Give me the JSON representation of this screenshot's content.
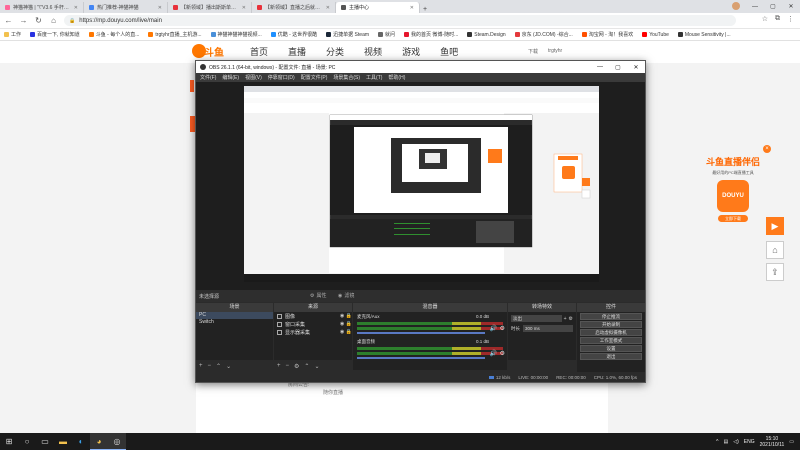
{
  "browser": {
    "tabs": [
      {
        "label": "神猫神猫 | ''\\\"V3.6 手杆→bilib",
        "color": "#ff6699",
        "active": false
      },
      {
        "label": "热门推荐-神猫神猫",
        "color": "#4285f4",
        "active": false
      },
      {
        "label": "【新领域】播出斯斯单中国-Gro",
        "color": "#e8313b",
        "active": false
      },
      {
        "label": "【新领域】直播之后就有分播出",
        "color": "#e8313b",
        "active": false
      },
      {
        "label": "主播中心",
        "color": "#555555",
        "active": true
      }
    ],
    "url": "https://mp.douyu.com/live/main",
    "bookmarks": [
      {
        "label": "工作",
        "color": "#f2c14e"
      },
      {
        "label": "百度一下, 你就知道",
        "color": "#2932e1"
      },
      {
        "label": "斗鱼 - 每个人的直...",
        "color": "#ff7700"
      },
      {
        "label": "trgtyhr直播_主机游...",
        "color": "#ff7700"
      },
      {
        "label": "神猫神猫神猫视频...",
        "color": "#4a90d9"
      },
      {
        "label": "优酷 - 这世界很酷",
        "color": "#1e90ff"
      },
      {
        "label": "迅捷单据 Steam",
        "color": "#1b2838"
      },
      {
        "label": "就问",
        "color": "#666666"
      },
      {
        "label": "我的首页 微博-随时...",
        "color": "#e6162d"
      },
      {
        "label": "Steam.Design",
        "color": "#333333"
      },
      {
        "label": "京东 (JD.COM) -综合...",
        "color": "#e4393c"
      },
      {
        "label": "淘宝网 - 淘！我喜欢",
        "color": "#ff5000"
      },
      {
        "label": "YouTube",
        "color": "#ff0000"
      },
      {
        "label": "Mouse Sensitivity |...",
        "color": "#333333"
      }
    ]
  },
  "douyu": {
    "logo": "斗鱼",
    "nav": [
      "首页",
      "直播",
      "分类",
      "视频",
      "游戏",
      "鱼吧"
    ],
    "download": "下载",
    "username": "trgtyhr",
    "notice_label": "房间公告:",
    "notice_value": "随你直播",
    "promo": {
      "title": "斗鱼直播伴侣",
      "subtitle": "最好用的PC端直播工具",
      "app": "DOUYU",
      "button": "立即下载"
    }
  },
  "obs": {
    "title": "OBS 26.1.1 (64-bit, windows) - 配置文件: 直播 - 场景: PC",
    "menu": [
      "文件(F)",
      "编辑(E)",
      "视图(V)",
      "停靠窗口(D)",
      "配置文件(P)",
      "场景集合(S)",
      "工具(T)",
      "帮助(H)"
    ],
    "no_source": "未选择源",
    "props_btn": "属性",
    "filters_btn": "滤镜",
    "panels": {
      "scenes": "场景",
      "sources": "来源",
      "mixer": "混音器",
      "transitions": "转场特效",
      "controls": "控件"
    },
    "scenes": [
      "PC",
      "Switch"
    ],
    "sources": [
      "图像",
      "窗口采集",
      "显示器采集"
    ],
    "mixer": [
      {
        "name": "麦克风/Aux",
        "db": "0.0 dB"
      },
      {
        "name": "桌面音频",
        "db": "0.1 dB"
      }
    ],
    "transition": {
      "type": "淡出",
      "duration_label": "时长",
      "duration_value": "300 ms"
    },
    "controls": [
      "停止推流",
      "开始录制",
      "启动虚拟摄像机",
      "工作室模式",
      "设置",
      "退出"
    ],
    "status": {
      "live": "LIVE: 00:00:00",
      "rec": "REC: 00:00:00",
      "cpu": "CPU: 1.0%, 60.00 fps",
      "bitrate": "12 kb/s"
    }
  },
  "taskbar": {
    "lang": "ENG",
    "time": "15:10",
    "date": "2021/10/11"
  }
}
